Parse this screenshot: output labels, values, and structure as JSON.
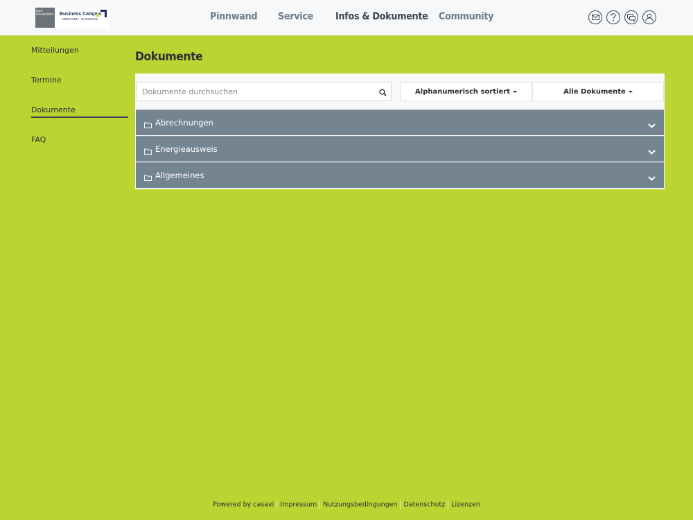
{
  "header": {
    "logo": {
      "box_text": "DER STANDORT",
      "title": "Business Campus",
      "subtitle": "MÜNCHEN · GARCHING"
    },
    "nav": [
      {
        "label": "Pinnwand",
        "active": false
      },
      {
        "label": "Service",
        "active": false
      },
      {
        "label": "Infos & Dokumente",
        "active": true
      },
      {
        "label": "Community",
        "active": false
      }
    ],
    "icons": [
      "mail-icon",
      "help-icon",
      "chat-icon",
      "user-icon"
    ]
  },
  "sidebar": {
    "items": [
      {
        "label": "Mitteilungen",
        "active": false
      },
      {
        "label": "Termine",
        "active": false
      },
      {
        "label": "Dokumente",
        "active": true
      },
      {
        "label": "FAQ",
        "active": false
      }
    ]
  },
  "main": {
    "title": "Dokumente",
    "search": {
      "placeholder": "Dokumente durchsuchen",
      "value": ""
    },
    "sort_dropdown": "Alphanumerisch sortiert",
    "filter_dropdown": "Alle Dokumente",
    "folders": [
      {
        "label": "Abrechnungen"
      },
      {
        "label": "Energieausweis"
      },
      {
        "label": "Allgemeines"
      }
    ]
  },
  "footer": {
    "links": [
      "Powered by casavi",
      "Impressum",
      "Nutzungsbedingungen",
      "Datenschutz",
      "Lizenzen"
    ]
  },
  "colors": {
    "background": "#bcd432",
    "header": "#f7f8f9",
    "folder_row": "#758491",
    "nav_text": "#6b7d8c",
    "nav_active": "#3c4650"
  }
}
